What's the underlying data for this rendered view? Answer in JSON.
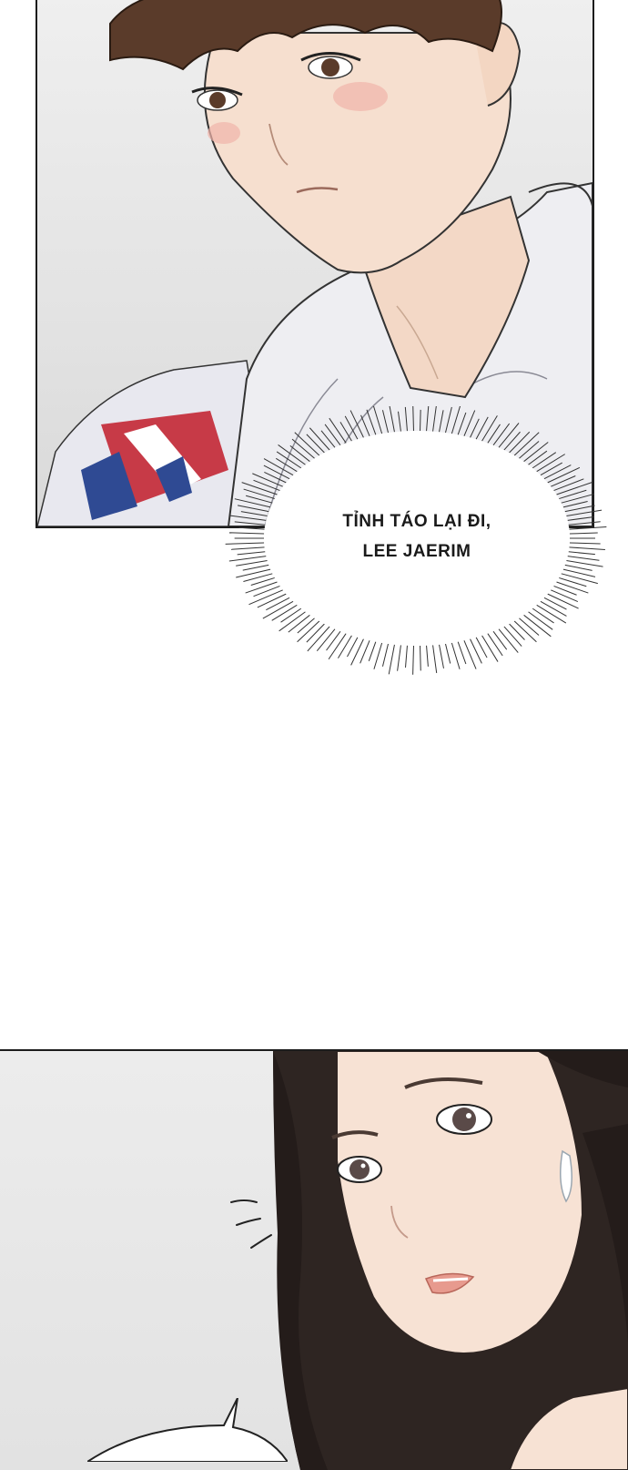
{
  "comic": {
    "panels": [
      {
        "name": "boy-closeup"
      },
      {
        "name": "girl-closeup"
      }
    ],
    "thought_bubble": {
      "line1": "TỈNH TÁO LẠI ĐI,",
      "line2": "LEE JAERIM"
    },
    "colors": {
      "ink": "#1c1c1c",
      "skin": "#f6dfcf",
      "hair_boy": "#5a3b2a",
      "hair_girl": "#2e2522",
      "hoodie": "#eeeef2",
      "flag_red": "#c73a47",
      "flag_blue": "#2f4a93"
    }
  }
}
